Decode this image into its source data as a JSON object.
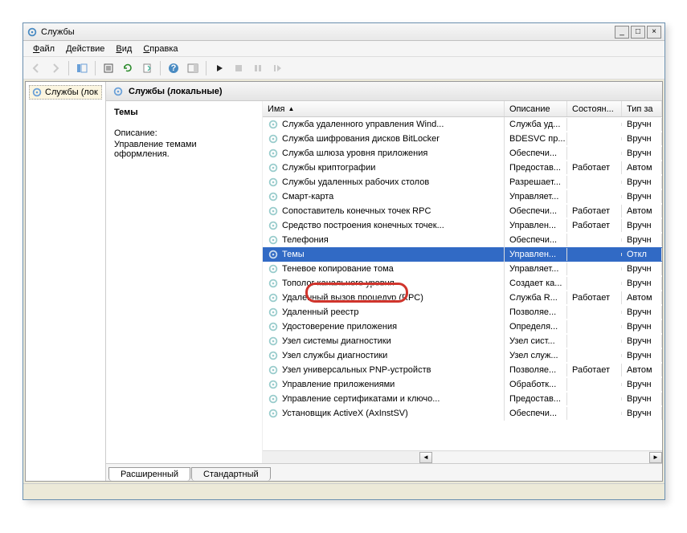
{
  "window": {
    "title": "Службы"
  },
  "menu": {
    "file": "Файл",
    "action": "Действие",
    "view": "Вид",
    "help": "Справка"
  },
  "tree": {
    "root": "Службы (лок"
  },
  "detail": {
    "header": "Службы (локальные)",
    "selected_name": "Темы",
    "desc_label": "Описание:",
    "desc_text": "Управление темами оформления."
  },
  "columns": {
    "name": "Имя",
    "description": "Описание",
    "status": "Состоян...",
    "startup": "Тип за"
  },
  "tabs": {
    "extended": "Расширенный",
    "standard": "Стандартный"
  },
  "services": [
    {
      "name": "Служба удаленного управления Wind...",
      "desc": "Служба уд...",
      "status": "",
      "startup": "Вручн"
    },
    {
      "name": "Служба шифрования дисков BitLocker",
      "desc": "BDESVC пр...",
      "status": "",
      "startup": "Вручн"
    },
    {
      "name": "Служба шлюза уровня приложения",
      "desc": "Обеспечи...",
      "status": "",
      "startup": "Вручн"
    },
    {
      "name": "Службы криптографии",
      "desc": "Предостав...",
      "status": "Работает",
      "startup": "Автом"
    },
    {
      "name": "Службы удаленных рабочих столов",
      "desc": "Разрешает...",
      "status": "",
      "startup": "Вручн"
    },
    {
      "name": "Смарт-карта",
      "desc": "Управляет...",
      "status": "",
      "startup": "Вручн"
    },
    {
      "name": "Сопоставитель конечных точек RPC",
      "desc": "Обеспечи...",
      "status": "Работает",
      "startup": "Автом"
    },
    {
      "name": "Средство построения конечных точек...",
      "desc": "Управлен...",
      "status": "Работает",
      "startup": "Вручн"
    },
    {
      "name": "Телефония",
      "desc": "Обеспечи...",
      "status": "",
      "startup": "Вручн"
    },
    {
      "name": "Темы",
      "desc": "Управлен...",
      "status": "",
      "startup": "Откл"
    },
    {
      "name": "Теневое копирование тома",
      "desc": "Управляет...",
      "status": "",
      "startup": "Вручн"
    },
    {
      "name": "Тополог канального уровня",
      "desc": "Создает ка...",
      "status": "",
      "startup": "Вручн"
    },
    {
      "name": "Удаленный вызов процедур (RPC)",
      "desc": "Служба R...",
      "status": "Работает",
      "startup": "Автом"
    },
    {
      "name": "Удаленный реестр",
      "desc": "Позволяе...",
      "status": "",
      "startup": "Вручн"
    },
    {
      "name": "Удостоверение приложения",
      "desc": "Определя...",
      "status": "",
      "startup": "Вручн"
    },
    {
      "name": "Узел системы диагностики",
      "desc": "Узел сист...",
      "status": "",
      "startup": "Вручн"
    },
    {
      "name": "Узел службы диагностики",
      "desc": "Узел служ...",
      "status": "",
      "startup": "Вручн"
    },
    {
      "name": "Узел универсальных PNP-устройств",
      "desc": "Позволяе...",
      "status": "Работает",
      "startup": "Автом"
    },
    {
      "name": "Управление приложениями",
      "desc": "Обработк...",
      "status": "",
      "startup": "Вручн"
    },
    {
      "name": "Управление сертификатами и ключо...",
      "desc": "Предостав...",
      "status": "",
      "startup": "Вручн"
    },
    {
      "name": "Установщик ActiveX (AxInstSV)",
      "desc": "Обеспечи...",
      "status": "",
      "startup": "Вручн"
    }
  ],
  "selected_index": 9
}
